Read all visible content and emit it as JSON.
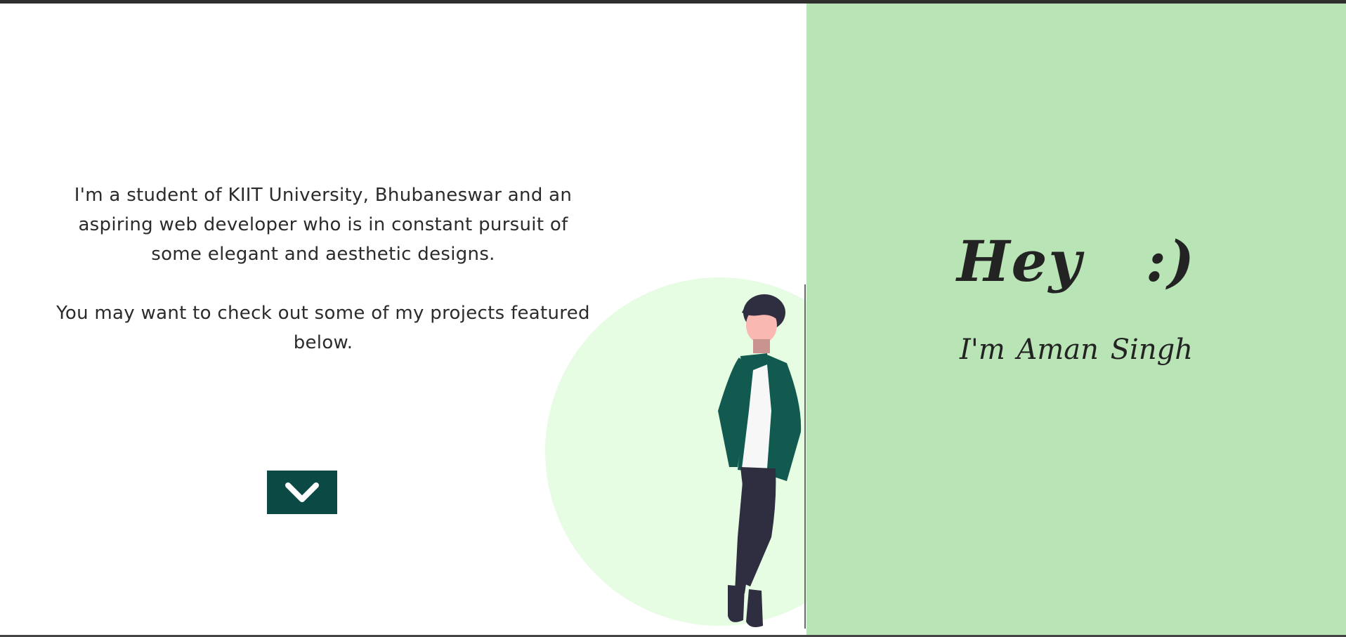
{
  "intro": {
    "paragraph1": "I'm a student of KIIT University, Bhubaneswar and an aspiring web developer who is in constant pursuit of some elegant and aesthetic designs.",
    "paragraph2": "You may want to check out some of my projects featured below."
  },
  "scroll_button": {
    "icon": "chevron-down-icon"
  },
  "hero": {
    "greeting": "Hey   :)",
    "name": "I'm Aman Singh"
  },
  "colors": {
    "accent_green_panel": "#b9e4b5",
    "circle_bg": "#e6fde3",
    "button_dark_teal": "#0b4a44",
    "text_dark": "#232323"
  }
}
